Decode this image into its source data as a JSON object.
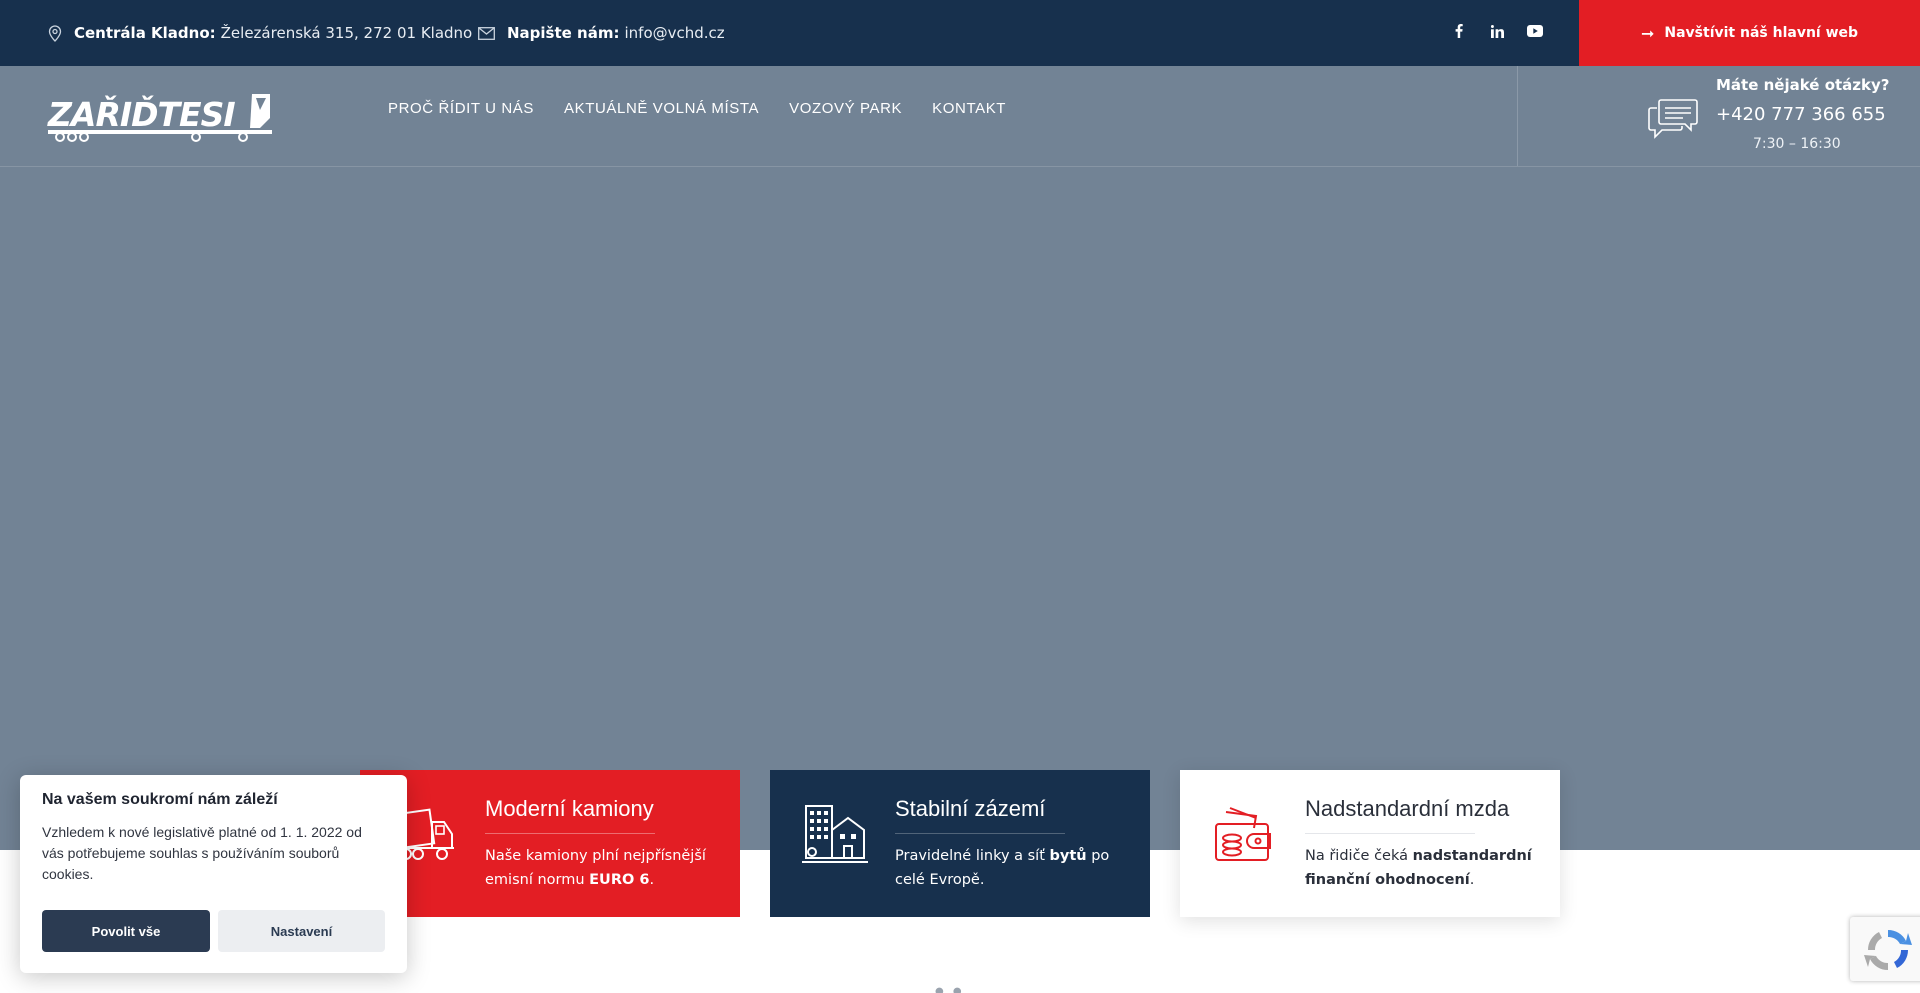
{
  "topbar": {
    "address_label": "Centrála Kladno:",
    "address_value": "Železárenská 315, 272 01 Kladno",
    "email_label": "Napište nám:",
    "email_value": "info@vchd.cz",
    "social": [
      "facebook-icon",
      "linkedin-icon",
      "youtube-icon"
    ],
    "cta_label": "Navštívit náš hlavní web"
  },
  "header": {
    "logo_text": "ZAŘIĎTESI",
    "menu": [
      {
        "label": "PROČ ŘÍDIT U NÁS"
      },
      {
        "label": "AKTUÁLNĚ VOLNÁ MÍSTA"
      },
      {
        "label": "VOZOVÝ PARK"
      },
      {
        "label": "KONTAKT"
      }
    ],
    "contact": {
      "question": "Máte nějaké otázky?",
      "phone": "+420 777 366 655",
      "hours": "7:30 – 16:30"
    }
  },
  "features": [
    {
      "title": "Moderní kamiony",
      "text_before": "Naše kamiony plní nejpřísnější emisní normu ",
      "text_bold": "EURO 6",
      "text_after": ".",
      "icon": "truck-icon"
    },
    {
      "title": "Stabilní zázemí",
      "text_before": "Pravidelné linky a síť ",
      "text_bold": "bytů",
      "text_after": " po celé Evropě.",
      "icon": "buildings-icon"
    },
    {
      "title": "Nadstandardní mzda",
      "text_before": "Na řidiče čeká ",
      "text_bold": "nadstandardní finanční ohodnocení",
      "text_after": ".",
      "icon": "wallet-icon"
    }
  ],
  "cookie": {
    "title": "Na vašem soukromí nám záleží",
    "text": "Vzhledem k nové legislativě platné od 1. 1. 2022 od vás potřebujeme souhlas s používáním souborů cookies.",
    "accept_label": "Povolit vše",
    "settings_label": "Nastavení"
  },
  "colors": {
    "navy": "#17304d",
    "red": "#e31e24",
    "hero": "#728395"
  }
}
